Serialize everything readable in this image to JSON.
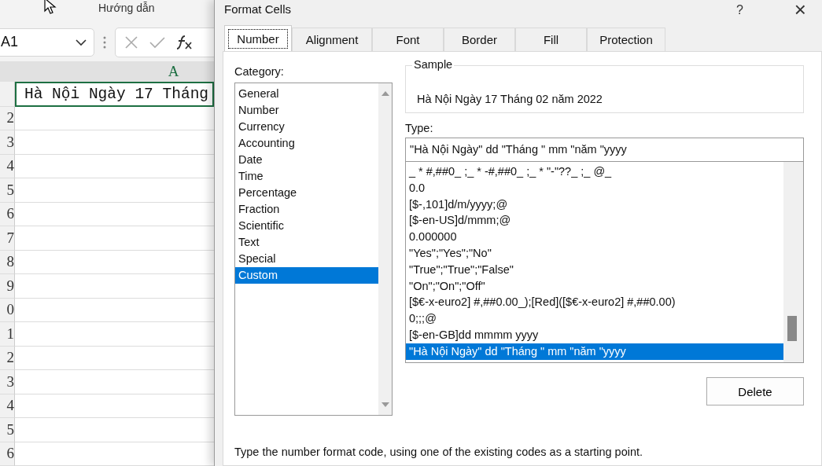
{
  "excel": {
    "ribbon_tab": "Hướng dẫn",
    "name_box": "A1",
    "column_header": "A",
    "cell_a1": "Hà Nội Ngày 17 Tháng",
    "row_numbers": [
      "2",
      "3",
      "4",
      "5",
      "6",
      "7",
      "8",
      "9",
      "0",
      "1",
      "2",
      "3",
      "4",
      "5",
      "6"
    ]
  },
  "dialog": {
    "title": "Format Cells",
    "help": "?",
    "close": "×",
    "tabs": [
      {
        "label": "Number",
        "selected": true
      },
      {
        "label": "Alignment",
        "selected": false
      },
      {
        "label": "Font",
        "selected": false
      },
      {
        "label": "Border",
        "selected": false
      },
      {
        "label": "Fill",
        "selected": false
      },
      {
        "label": "Protection",
        "selected": false
      }
    ],
    "category_label": "Category:",
    "categories": [
      {
        "label": "General",
        "selected": false
      },
      {
        "label": "Number",
        "selected": false
      },
      {
        "label": "Currency",
        "selected": false
      },
      {
        "label": "Accounting",
        "selected": false
      },
      {
        "label": "Date",
        "selected": false
      },
      {
        "label": "Time",
        "selected": false
      },
      {
        "label": "Percentage",
        "selected": false
      },
      {
        "label": "Fraction",
        "selected": false
      },
      {
        "label": "Scientific",
        "selected": false
      },
      {
        "label": "Text",
        "selected": false
      },
      {
        "label": "Special",
        "selected": false
      },
      {
        "label": "Custom",
        "selected": true
      }
    ],
    "sample_label": "Sample",
    "sample": "Hà Nội Ngày 17 Tháng  02 năm 2022",
    "type_label": "Type:",
    "type_value": "\"Hà Nội Ngày\" dd \"Tháng \" mm \"năm \"yyyy",
    "type_list": [
      {
        "label": "_ * #,##0_ ;_ * -#,##0_ ;_ * \"-\"??_ ;_ @_",
        "selected": false
      },
      {
        "label": "0.0",
        "selected": false
      },
      {
        "label": "[$-,101]d/m/yyyy;@",
        "selected": false
      },
      {
        "label": "[$-en-US]d/mmm;@",
        "selected": false
      },
      {
        "label": "0.000000",
        "selected": false
      },
      {
        "label": "\"Yes\";\"Yes\";\"No\"",
        "selected": false
      },
      {
        "label": "\"True\";\"True\";\"False\"",
        "selected": false
      },
      {
        "label": "\"On\";\"On\";\"Off\"",
        "selected": false
      },
      {
        "label": "[$€-x-euro2] #,##0.00_);[Red]([$€-x-euro2] #,##0.00)",
        "selected": false
      },
      {
        "label": "0;;;@",
        "selected": false
      },
      {
        "label": "[$-en-GB]dd mmmm yyyy",
        "selected": false
      },
      {
        "label": "\"Hà Nội Ngày\" dd \"Tháng \" mm \"năm \"yyyy",
        "selected": true
      }
    ],
    "delete_button": "Delete",
    "hint": "Type the number format code, using one of the existing codes as a starting point."
  }
}
